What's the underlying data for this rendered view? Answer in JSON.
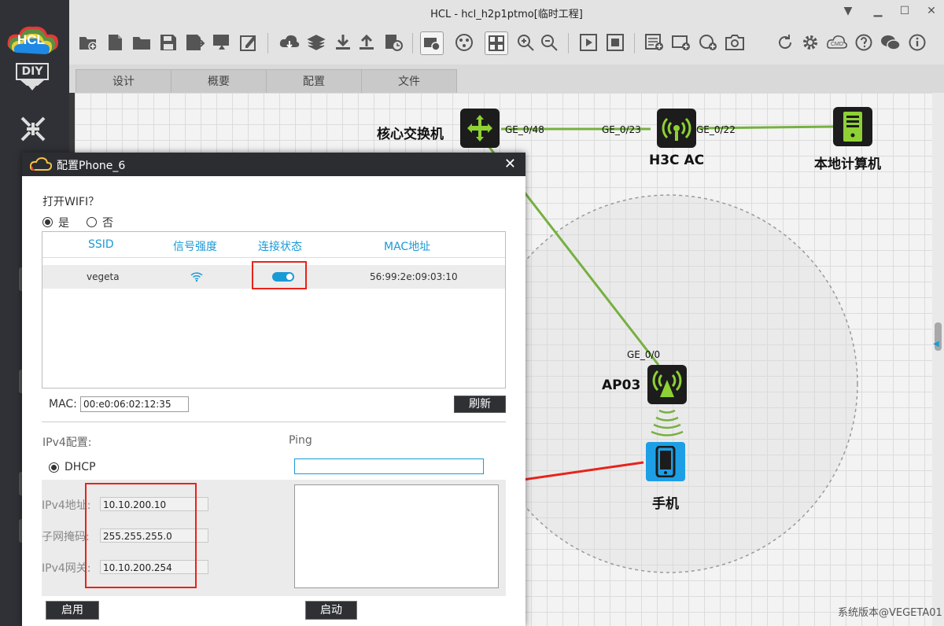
{
  "window": {
    "title": "HCL - hcl_h2p1ptmo[临时工程]"
  },
  "app": {
    "logo_text": "HCL",
    "diy_text": "DIY"
  },
  "tabs": [
    {
      "label": "设计"
    },
    {
      "label": "概要"
    },
    {
      "label": "配置"
    },
    {
      "label": "文件"
    }
  ],
  "topology": {
    "devices": {
      "core_switch": "核心交换机",
      "ac": "H3C AC",
      "host": "本地计算机",
      "ap": "AP03",
      "phone": "手机"
    },
    "ports": {
      "core_ge": "GE_0/48",
      "ac_ge_left": "GE_0/23",
      "ac_ge_right": "GE_0/22",
      "ap_ge": "GE_0/0"
    }
  },
  "dialog": {
    "title": "配置Phone_6",
    "wifi_question": "打开WIFI？",
    "radio_yes": "是",
    "radio_no": "否",
    "radio_selected": "yes",
    "table": {
      "headers": [
        "SSID",
        "信号强度",
        "连接状态",
        "MAC地址"
      ],
      "rows": [
        {
          "ssid": "vegeta",
          "signal_icon": "wifi-signal-icon",
          "connected": true,
          "mac": "56:99:2e:09:03:10"
        }
      ]
    },
    "mac_label": "MAC:",
    "mac_value": "00:e0:06:02:12:35",
    "refresh_button": "刷新",
    "ipv4_section": "IPv4配置:",
    "dhcp_label": "DHCP",
    "ipv4_addr_label": "IPv4地址:",
    "ipv4_addr_value": "10.10.200.10",
    "mask_label": "子网掩码:",
    "mask_value": "255.255.255.0",
    "gateway_label": "IPv4网关:",
    "gateway_value": "10.10.200.254",
    "ping_label": "Ping",
    "ping_input": "",
    "apply_button": "启用",
    "start_button": "启动"
  },
  "watermark": "系统版本@VEGETA01",
  "colors": {
    "link_green": "#76b041",
    "accent_blue": "#1a9ad6",
    "annotation_red": "#e8231a",
    "dark_panel": "#2b2d31"
  }
}
